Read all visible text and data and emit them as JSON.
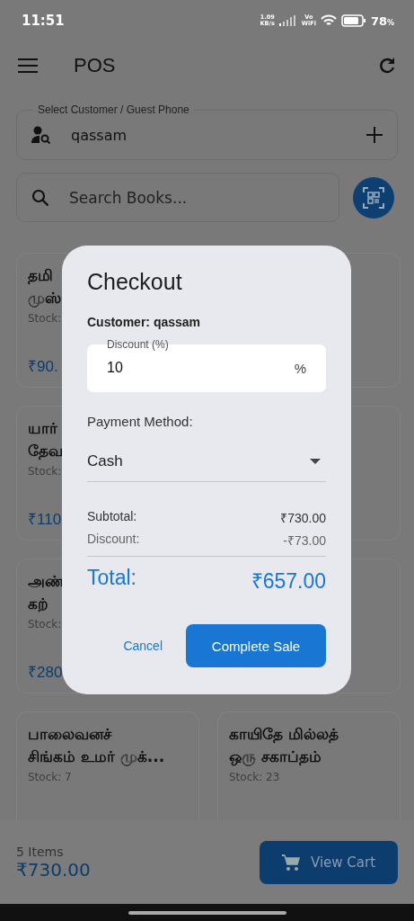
{
  "status_bar": {
    "time": "11:51",
    "speed": "1.09",
    "speed_unit": "KB/s",
    "vowifi": "Vo",
    "vowifi_sub": "WiFi",
    "battery": "78",
    "battery_unit": "%"
  },
  "app_bar": {
    "title": "POS"
  },
  "customer_field": {
    "label": "Select Customer / Guest Phone",
    "value": "qassam"
  },
  "search": {
    "placeholder": "Search Books..."
  },
  "books": [
    {
      "kind": "book",
      "title_lines": [
        "தமி",
        "முஸ்"
      ],
      "stock": "Stock:",
      "price": "₹90."
    },
    {
      "kind": "covered"
    },
    {
      "kind": "book",
      "title_lines": [
        "யார்",
        "தேவ"
      ],
      "stock": "Stock:",
      "price": "₹110"
    },
    {
      "kind": "covered"
    },
    {
      "kind": "book",
      "title_lines": [
        "அண்",
        "கற்"
      ],
      "stock": "Stock:",
      "price": "₹280"
    },
    {
      "kind": "covered"
    },
    {
      "kind": "book",
      "title_lines": [
        "பாலைவனச்",
        "சிங்கம் உமர் முக்..."
      ],
      "stock": "Stock: 7"
    },
    {
      "kind": "book",
      "title_lines": [
        "காயிதே மில்லத்",
        "ஒரு சகாப்தம்"
      ],
      "stock": "Stock: 23"
    }
  ],
  "cart_bar": {
    "count": "5 Items",
    "total": "₹730.00",
    "button": "View Cart"
  },
  "dialog": {
    "title": "Checkout",
    "customer": "Customer: qassam",
    "discount_field": {
      "label": "Discount (%)",
      "value": "10",
      "suffix": "%"
    },
    "payment_label": "Payment Method:",
    "payment_value": "Cash",
    "summary": [
      {
        "label": "Subtotal:",
        "value": "₹730.00",
        "kind": "normal"
      },
      {
        "label": "Discount:",
        "value": "-₹73.00",
        "kind": "muted"
      }
    ],
    "total": {
      "label": "Total:",
      "value": "₹657.00"
    },
    "buttons": [
      {
        "label": "Cancel",
        "kind": "text"
      },
      {
        "label": "Complete Sale",
        "kind": "filled"
      }
    ]
  }
}
